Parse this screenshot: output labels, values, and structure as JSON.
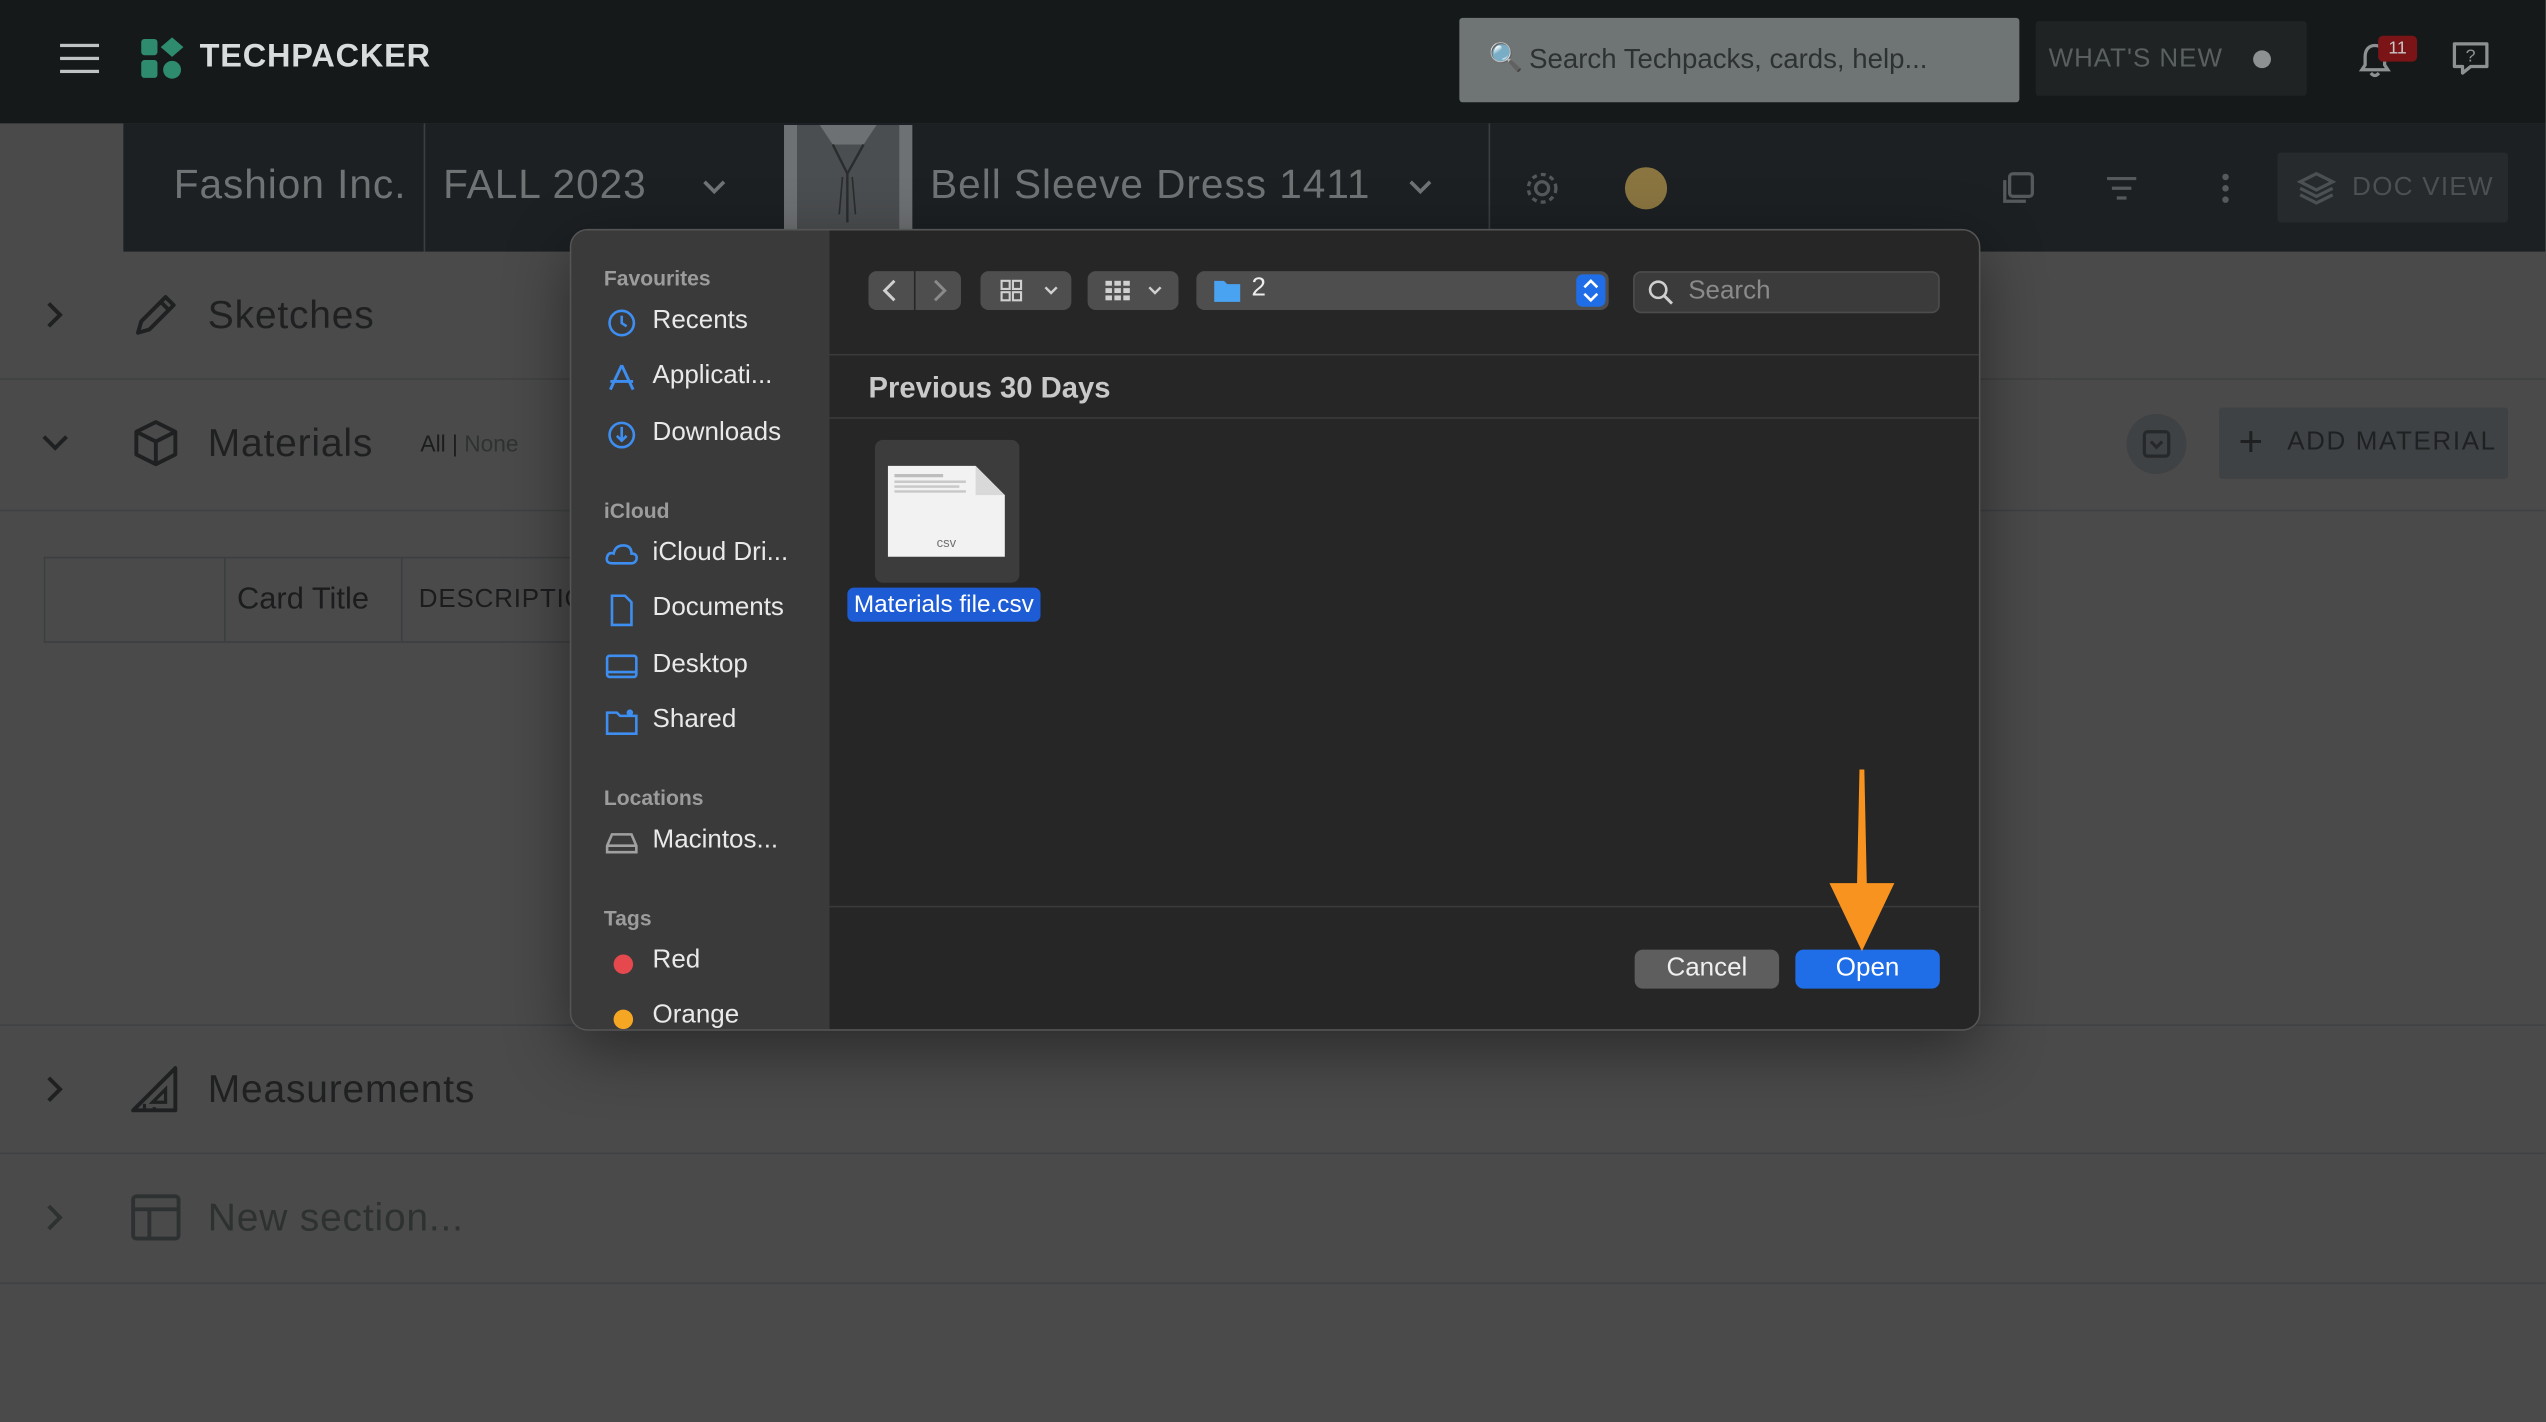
{
  "app": {
    "name": "TECHPACKER",
    "search_placeholder": "Search Techpacks, cards, help...",
    "whats_new_label": "WHAT'S NEW",
    "notification_count": "11"
  },
  "techpack_bar": {
    "company": "Fashion Inc.",
    "season": "FALL 2023",
    "product": "Bell Sleeve Dress 1411",
    "doc_view_label": "DOC VIEW"
  },
  "sections": {
    "sketches": "Sketches",
    "materials": "Materials",
    "materials_filter_all": "All",
    "materials_filter_sep": " | ",
    "materials_filter_none": "None",
    "add_material_label": "ADD MATERIAL",
    "table_headers": [
      "",
      "Card Title",
      "DESCRIPTIO"
    ],
    "measurements": "Measurements",
    "new_section_placeholder": "New section..."
  },
  "file_dialog": {
    "sidebar": {
      "favourites_heading": "Favourites",
      "favourites": [
        "Recents",
        "Applicati...",
        "Downloads"
      ],
      "icloud_heading": "iCloud",
      "icloud": [
        "iCloud Dri...",
        "Documents",
        "Desktop",
        "Shared"
      ],
      "locations_heading": "Locations",
      "locations": [
        "Macintos..."
      ],
      "tags_heading": "Tags",
      "tags": [
        {
          "label": "Red",
          "color": "#e5484d"
        },
        {
          "label": "Orange",
          "color": "#f5a623"
        }
      ]
    },
    "current_folder": "2",
    "search_placeholder": "Search",
    "group_title": "Previous 30 Days",
    "files": [
      {
        "name": "Materials file.csv",
        "type_label": "csv",
        "selected": true
      }
    ],
    "cancel_label": "Cancel",
    "open_label": "Open"
  },
  "colors": {
    "accent_blue": "#1f6ee8",
    "annotation_arrow": "#f7931e",
    "logo_green": "#2e8b6e"
  }
}
